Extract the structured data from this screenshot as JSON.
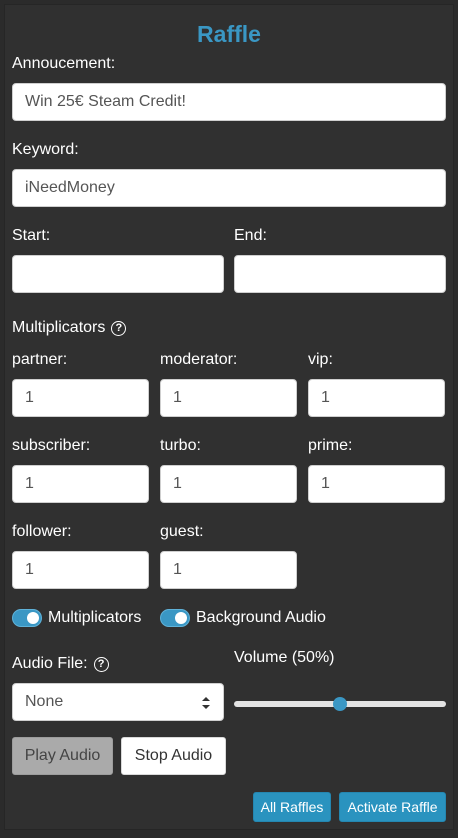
{
  "raffle": {
    "title": "Raffle",
    "announcement": {
      "label": "Annoucement:",
      "value": "Win 25€ Steam Credit!"
    },
    "keyword": {
      "label": "Keyword:",
      "value": "iNeedMoney"
    },
    "start": {
      "label": "Start:",
      "value": ""
    },
    "end": {
      "label": "End:",
      "value": ""
    },
    "multiplicators": {
      "heading": "Multiplicators",
      "help_icon": "question-circle-icon",
      "fields": [
        {
          "label": "partner:",
          "value": "1"
        },
        {
          "label": "moderator:",
          "value": "1"
        },
        {
          "label": "vip:",
          "value": "1"
        },
        {
          "label": "subscriber:",
          "value": "1"
        },
        {
          "label": "turbo:",
          "value": "1"
        },
        {
          "label": "prime:",
          "value": "1"
        },
        {
          "label": "follower:",
          "value": "1"
        },
        {
          "label": "guest:",
          "value": "1"
        }
      ]
    },
    "toggles": [
      {
        "label": "Multiplicators",
        "on": true
      },
      {
        "label": "Background Audio",
        "on": true
      }
    ],
    "audio_file": {
      "label": "Audio File:",
      "selected": "None",
      "help_icon": "question-circle-icon"
    },
    "volume": {
      "label": "Volume (50%)",
      "value": 0.5
    },
    "buttons": {
      "play_audio": "Play Audio",
      "stop_audio": "Stop Audio",
      "all_raffles": "All Raffles",
      "activate_raffle": "Activate Raffle"
    },
    "colors": {
      "accent": "#3a97c4",
      "panel": "#303030"
    }
  }
}
